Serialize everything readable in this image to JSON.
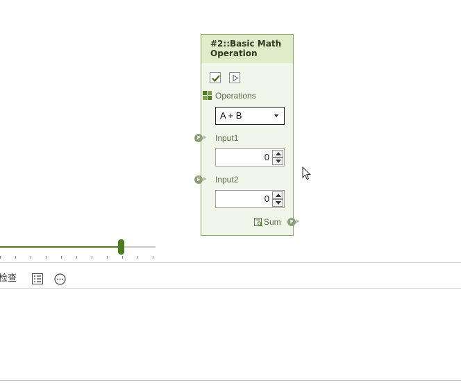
{
  "node": {
    "title": "#2::Basic Math Operation",
    "operations_label": "Operations",
    "operation_selected": "A + B",
    "input1_label": "Input1",
    "input1_value": "0",
    "input2_label": "Input2",
    "input2_value": "0",
    "output_label": "Sum",
    "port_glyph": "F",
    "colors": {
      "header": "#dfecc9",
      "body": "#f1f6ea",
      "border": "#8bae66",
      "accent": "#4b7c1e",
      "port": "#8ea079"
    },
    "icons": {
      "enable": "checkmark-icon",
      "run": "play-icon",
      "operations": "grid-icon",
      "output": "preview-icon"
    }
  },
  "slider": {
    "value_fraction": 0.78
  },
  "toolbar": {
    "check_label": "检查",
    "icons": [
      "list-view-icon",
      "more-options-icon"
    ]
  }
}
